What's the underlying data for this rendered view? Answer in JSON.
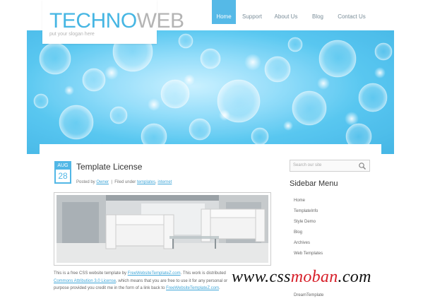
{
  "header": {
    "logo_part1": "TECHNO",
    "logo_part2": "WEB",
    "slogan": "put your slogan here"
  },
  "nav": {
    "items": [
      {
        "label": "Home",
        "active": true
      },
      {
        "label": "Support",
        "active": false
      },
      {
        "label": "About Us",
        "active": false
      },
      {
        "label": "Blog",
        "active": false
      },
      {
        "label": "Contact Us",
        "active": false
      }
    ]
  },
  "post": {
    "date_month": "AUG",
    "date_day": "28",
    "title": "Template License",
    "meta_posted_by": "Posted by",
    "meta_author": "Owner",
    "meta_filed_under": "Filed under",
    "meta_tag1": "templates",
    "meta_tag2": "internet",
    "body_1": "This is a free CSS website template by",
    "body_link1": "FreeWebsiteTemplateZ.com",
    "body_2": ". This work is distributed",
    "body_link2": "Commons Attribution 3.0 License",
    "body_3": ", which means that you are free to use it for any personal or",
    "body_4": "purpose provided you credit me in the form of a link back to",
    "body_link3": "FreeWebsiteTemplateZ.com",
    "body_5": "."
  },
  "sidebar": {
    "search_placeholder": "Search our site",
    "title": "Sidebar Menu",
    "items": [
      "Home",
      "TemplateInfo",
      "Style Demo",
      "Blog",
      "Archives",
      "Web Templates",
      "DreamTemplate"
    ]
  },
  "watermark": {
    "part1": "www.css",
    "part2": "moban",
    "part3": ".com"
  },
  "colors": {
    "accent": "#55b9e7",
    "link": "#3fa6d8",
    "watermark_red": "#d7202a"
  },
  "icons": {
    "search": "magnifier-icon"
  }
}
